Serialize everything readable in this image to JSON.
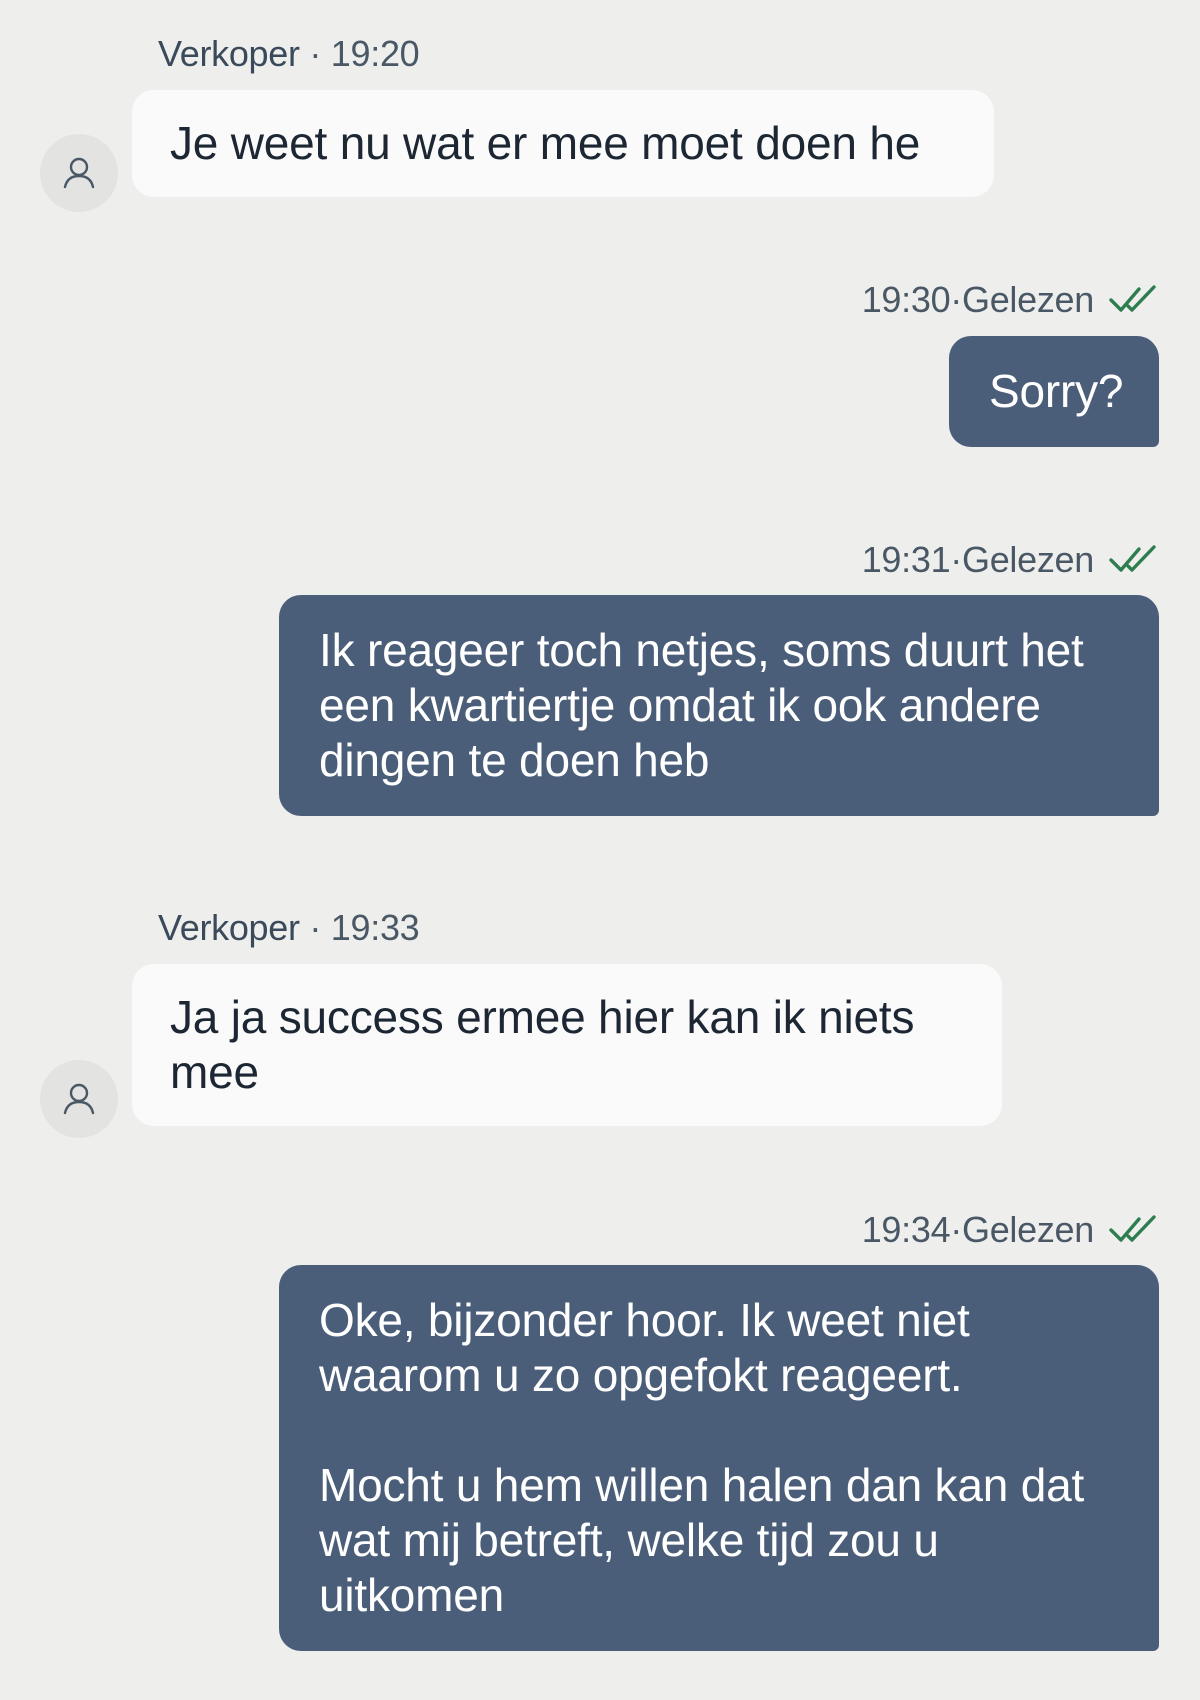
{
  "messages": [
    {
      "direction": "incoming",
      "sender": "Verkoper",
      "time": "19:20",
      "avatar_icon": "user-icon",
      "paragraphs": [
        "Je weet nu wat er mee moet doen he"
      ]
    },
    {
      "direction": "outgoing",
      "time": "19:30",
      "status": "Gelezen",
      "status_icon": "double-check-icon",
      "paragraphs": [
        "Sorry?"
      ]
    },
    {
      "direction": "outgoing",
      "time": "19:31",
      "status": "Gelezen",
      "status_icon": "double-check-icon",
      "paragraphs": [
        "Ik reageer toch netjes, soms duurt het een kwartiertje omdat ik ook andere dingen te doen heb"
      ]
    },
    {
      "direction": "incoming",
      "sender": "Verkoper",
      "time": "19:33",
      "avatar_icon": "user-icon",
      "paragraphs": [
        "Ja ja success ermee hier kan ik niets mee"
      ]
    },
    {
      "direction": "outgoing",
      "time": "19:34",
      "status": "Gelezen",
      "status_icon": "double-check-icon",
      "paragraphs": [
        "Oke, bijzonder hoor. Ik weet niet waarom u zo opgefokt reageert.",
        "Mocht u hem willen halen dan kan dat wat mij betreft, welke tijd zou u uitkomen"
      ]
    }
  ],
  "colors": {
    "background": "#eeeeed",
    "incoming_bubble": "#fafafa",
    "outgoing_bubble": "#4b5e79",
    "read_check": "#2e7d4f"
  },
  "separator": " · "
}
